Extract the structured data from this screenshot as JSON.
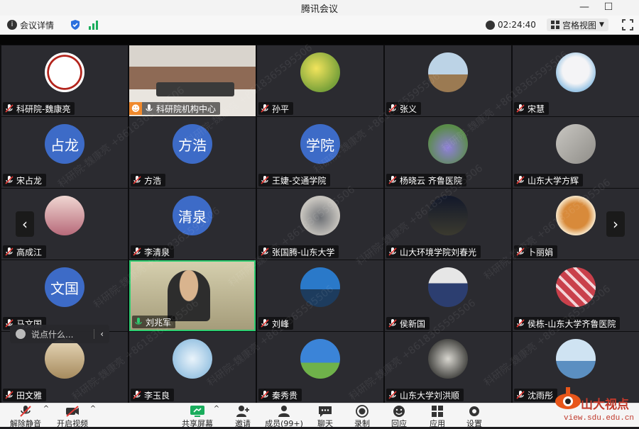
{
  "window": {
    "title": "腾讯会议"
  },
  "toolbar": {
    "meeting_info": "会议详情",
    "timer": "02:24:40",
    "view_mode": "宫格视图"
  },
  "tiles": [
    {
      "name": "科研院-魏康亮",
      "avatar": "logo"
    },
    {
      "name": "科研院机构中心",
      "avatar": "video-room"
    },
    {
      "name": "孙平",
      "avatar": "flower-yellow"
    },
    {
      "name": "张义",
      "avatar": "horses"
    },
    {
      "name": "宋慧",
      "avatar": "seal"
    },
    {
      "name": "宋占龙",
      "avatar": "text",
      "avatar_text": "占龙"
    },
    {
      "name": "方浩",
      "avatar": "text",
      "avatar_text": "方浩"
    },
    {
      "name": "王婕-交通学院",
      "avatar": "text",
      "avatar_text": "学院"
    },
    {
      "name": "杨晓云  齐鲁医院",
      "avatar": "flowers-purple"
    },
    {
      "name": "山东大学方辉",
      "avatar": "stone"
    },
    {
      "name": "高成江",
      "avatar": "piano"
    },
    {
      "name": "李清泉",
      "avatar": "text",
      "avatar_text": "清泉"
    },
    {
      "name": "张国腾-山东大学",
      "avatar": "bird"
    },
    {
      "name": "山大环境学院刘春光",
      "avatar": "night"
    },
    {
      "name": "卜丽娟",
      "avatar": "bears"
    },
    {
      "name": "马文国",
      "avatar": "text",
      "avatar_text": "文国"
    },
    {
      "name": "刘兆军",
      "avatar": "video-person"
    },
    {
      "name": "刘峰",
      "avatar": "opera"
    },
    {
      "name": "侯新国",
      "avatar": "suit"
    },
    {
      "name": "侯栋-山东大学齐鲁医院",
      "avatar": "cubes"
    },
    {
      "name": "田文雅",
      "avatar": "room"
    },
    {
      "name": "李玉良",
      "avatar": "map"
    },
    {
      "name": "秦秀贵",
      "avatar": "sky"
    },
    {
      "name": "山东大学刘洪顺",
      "avatar": "horse-ink"
    },
    {
      "name": "沈雨彤",
      "avatar": "lake"
    }
  ],
  "chat": {
    "placeholder": "说点什么..."
  },
  "watermark": "科研院-魏康亮 +8618365595506",
  "bottombar": {
    "unmute": "解除静音",
    "video": "开启视频",
    "share": "共享屏幕",
    "invite": "邀请",
    "members": "成员(99+)",
    "chat": "聊天",
    "record": "录制",
    "apps": "应用",
    "settings": "设置",
    "react": "回应"
  },
  "brand": {
    "name": "山大视点",
    "url": "view.sdu.edu.cn"
  },
  "colors": {
    "accent": "#3d6bc7",
    "speaking": "#2ecc71",
    "mute": "#e53935",
    "share_green": "#1aad5c"
  }
}
